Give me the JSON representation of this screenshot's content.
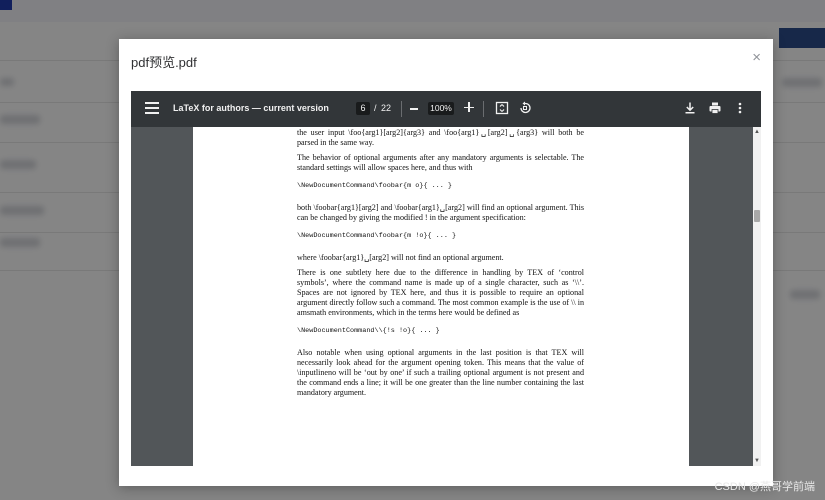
{
  "modal": {
    "title": "pdf预览.pdf",
    "close_glyph": "×"
  },
  "viewer": {
    "menu_icon": "hamburger-menu-icon",
    "doc_title": "LaTeX for authors — current version",
    "current_page": "6",
    "page_separator": "/",
    "total_pages": "22",
    "zoom": "100%",
    "icons": [
      "fit-page-icon",
      "rotate-icon",
      "download-icon",
      "print-icon",
      "more-vert-icon"
    ],
    "toolbar_color": "#323639",
    "background_color": "#525659"
  },
  "page": {
    "paragraphs": [
      "the user input \\foo{arg1}[arg2]{arg3} and \\foo{arg1}␣[arg2]␣{arg3} will both be parsed in the same way.",
      "The behavior of optional arguments after any mandatory arguments is selectable. The standard settings will allow spaces here, and thus with",
      "\\NewDocumentCommand\\foobar{m o}{ ... }",
      "both \\foobar{arg1}[arg2] and \\foobar{arg1}␣[arg2] will find an optional argument. This can be changed by giving the modified ! in the argument specification:",
      "\\NewDocumentCommand\\foobar{m !o}{ ... }",
      "where \\foobar{arg1}␣[arg2] will not find an optional argument.",
      "There is one subtlety here due to the difference in handling by TEX of ‘control symbols’, where the command name is made up of a single character, such as ‘\\\\’. Spaces are not ignored by TEX here, and thus it is possible to require an optional argument directly follow such a command. The most common example is the use of \\\\ in amsmath environments, which in the terms here would be defined as",
      "\\NewDocumentCommand\\\\{!s !o}{ ... }",
      "Also notable when using optional arguments in the last position is that TEX will necessarily look ahead for the argument opening token. This means that the value of \\inputlineno will be ‘out by one’ if such a trailing optional argument is not present and the command ends a line; it will be one greater than the line number containing the last mandatory argument."
    ]
  },
  "watermark": "CSDN @燕哥学前端"
}
